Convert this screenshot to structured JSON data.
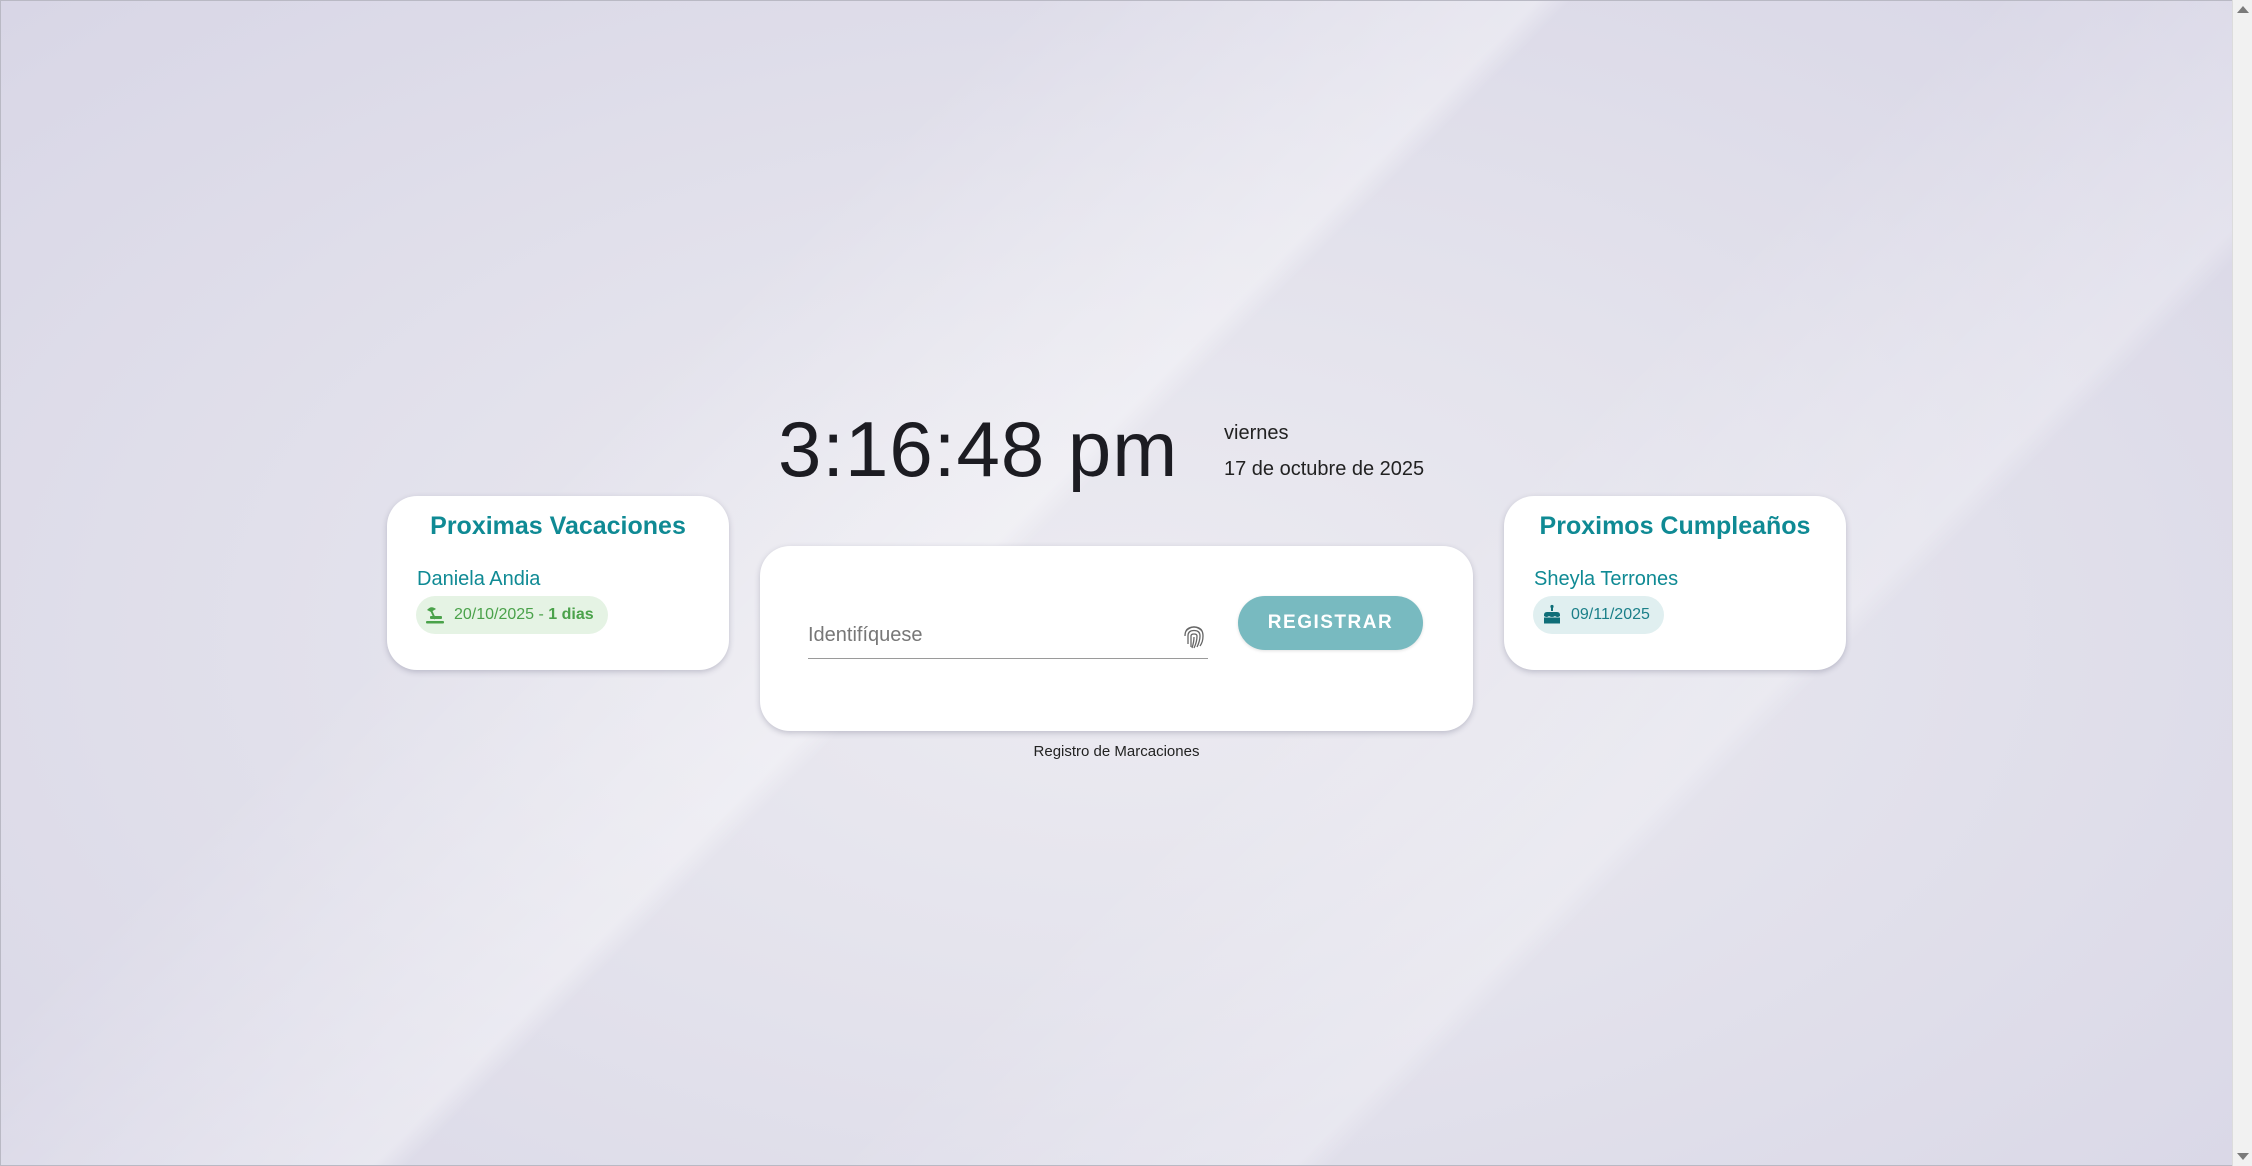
{
  "clock": {
    "time": "3:16:48 pm",
    "weekday": "viernes",
    "date": "17 de octubre de 2025"
  },
  "vacations": {
    "title": "Proximas Vacaciones",
    "person": "Daniela Andia",
    "date": "20/10/2025",
    "separator": " - ",
    "days": "1 dias",
    "icon": "beach-umbrella-icon"
  },
  "birthdays": {
    "title": "Proximos Cumpleaños",
    "person": "Sheyla Terrones",
    "date": "09/11/2025",
    "icon": "cake-icon"
  },
  "register": {
    "placeholder": "Identifíquese",
    "button_label": "REGISTRAR",
    "caption": "Registro de Marcaciones",
    "field_icon": "fingerprint-icon"
  },
  "colors": {
    "accent": "#0f8a94",
    "button": "#78bac0",
    "vacation_chip_bg": "#e5f3e4",
    "vacation_chip_text": "#4aa24a",
    "birthday_chip_bg": "#e0eff0"
  }
}
